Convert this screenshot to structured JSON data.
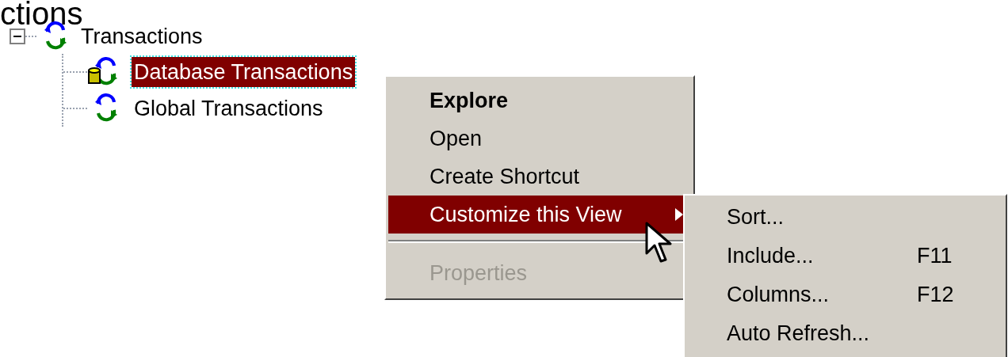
{
  "heading": "ctions",
  "tree": {
    "label": "Transactions",
    "expanded": true,
    "children": [
      {
        "label": "Database Transactions",
        "kind": "database",
        "selected": true
      },
      {
        "label": "Global Transactions",
        "kind": "global",
        "selected": false
      }
    ]
  },
  "context_menu": {
    "items": [
      {
        "kind": "item",
        "label": "Explore",
        "default": true,
        "selected": false,
        "disabled": false,
        "has_submenu": false
      },
      {
        "kind": "item",
        "label": "Open",
        "default": false,
        "selected": false,
        "disabled": false,
        "has_submenu": false
      },
      {
        "kind": "item",
        "label": "Create Shortcut",
        "default": false,
        "selected": false,
        "disabled": false,
        "has_submenu": false
      },
      {
        "kind": "item",
        "label": "Customize this View",
        "default": false,
        "selected": true,
        "disabled": false,
        "has_submenu": true
      },
      {
        "kind": "separator"
      },
      {
        "kind": "item",
        "label": "Properties",
        "default": false,
        "selected": false,
        "disabled": true,
        "has_submenu": false
      }
    ]
  },
  "submenu": {
    "items": [
      {
        "label": "Sort..."
      },
      {
        "label": "Include...",
        "shortcut": "F11"
      },
      {
        "label": "Columns...",
        "shortcut": "F12"
      },
      {
        "label": "Auto Refresh..."
      }
    ]
  }
}
